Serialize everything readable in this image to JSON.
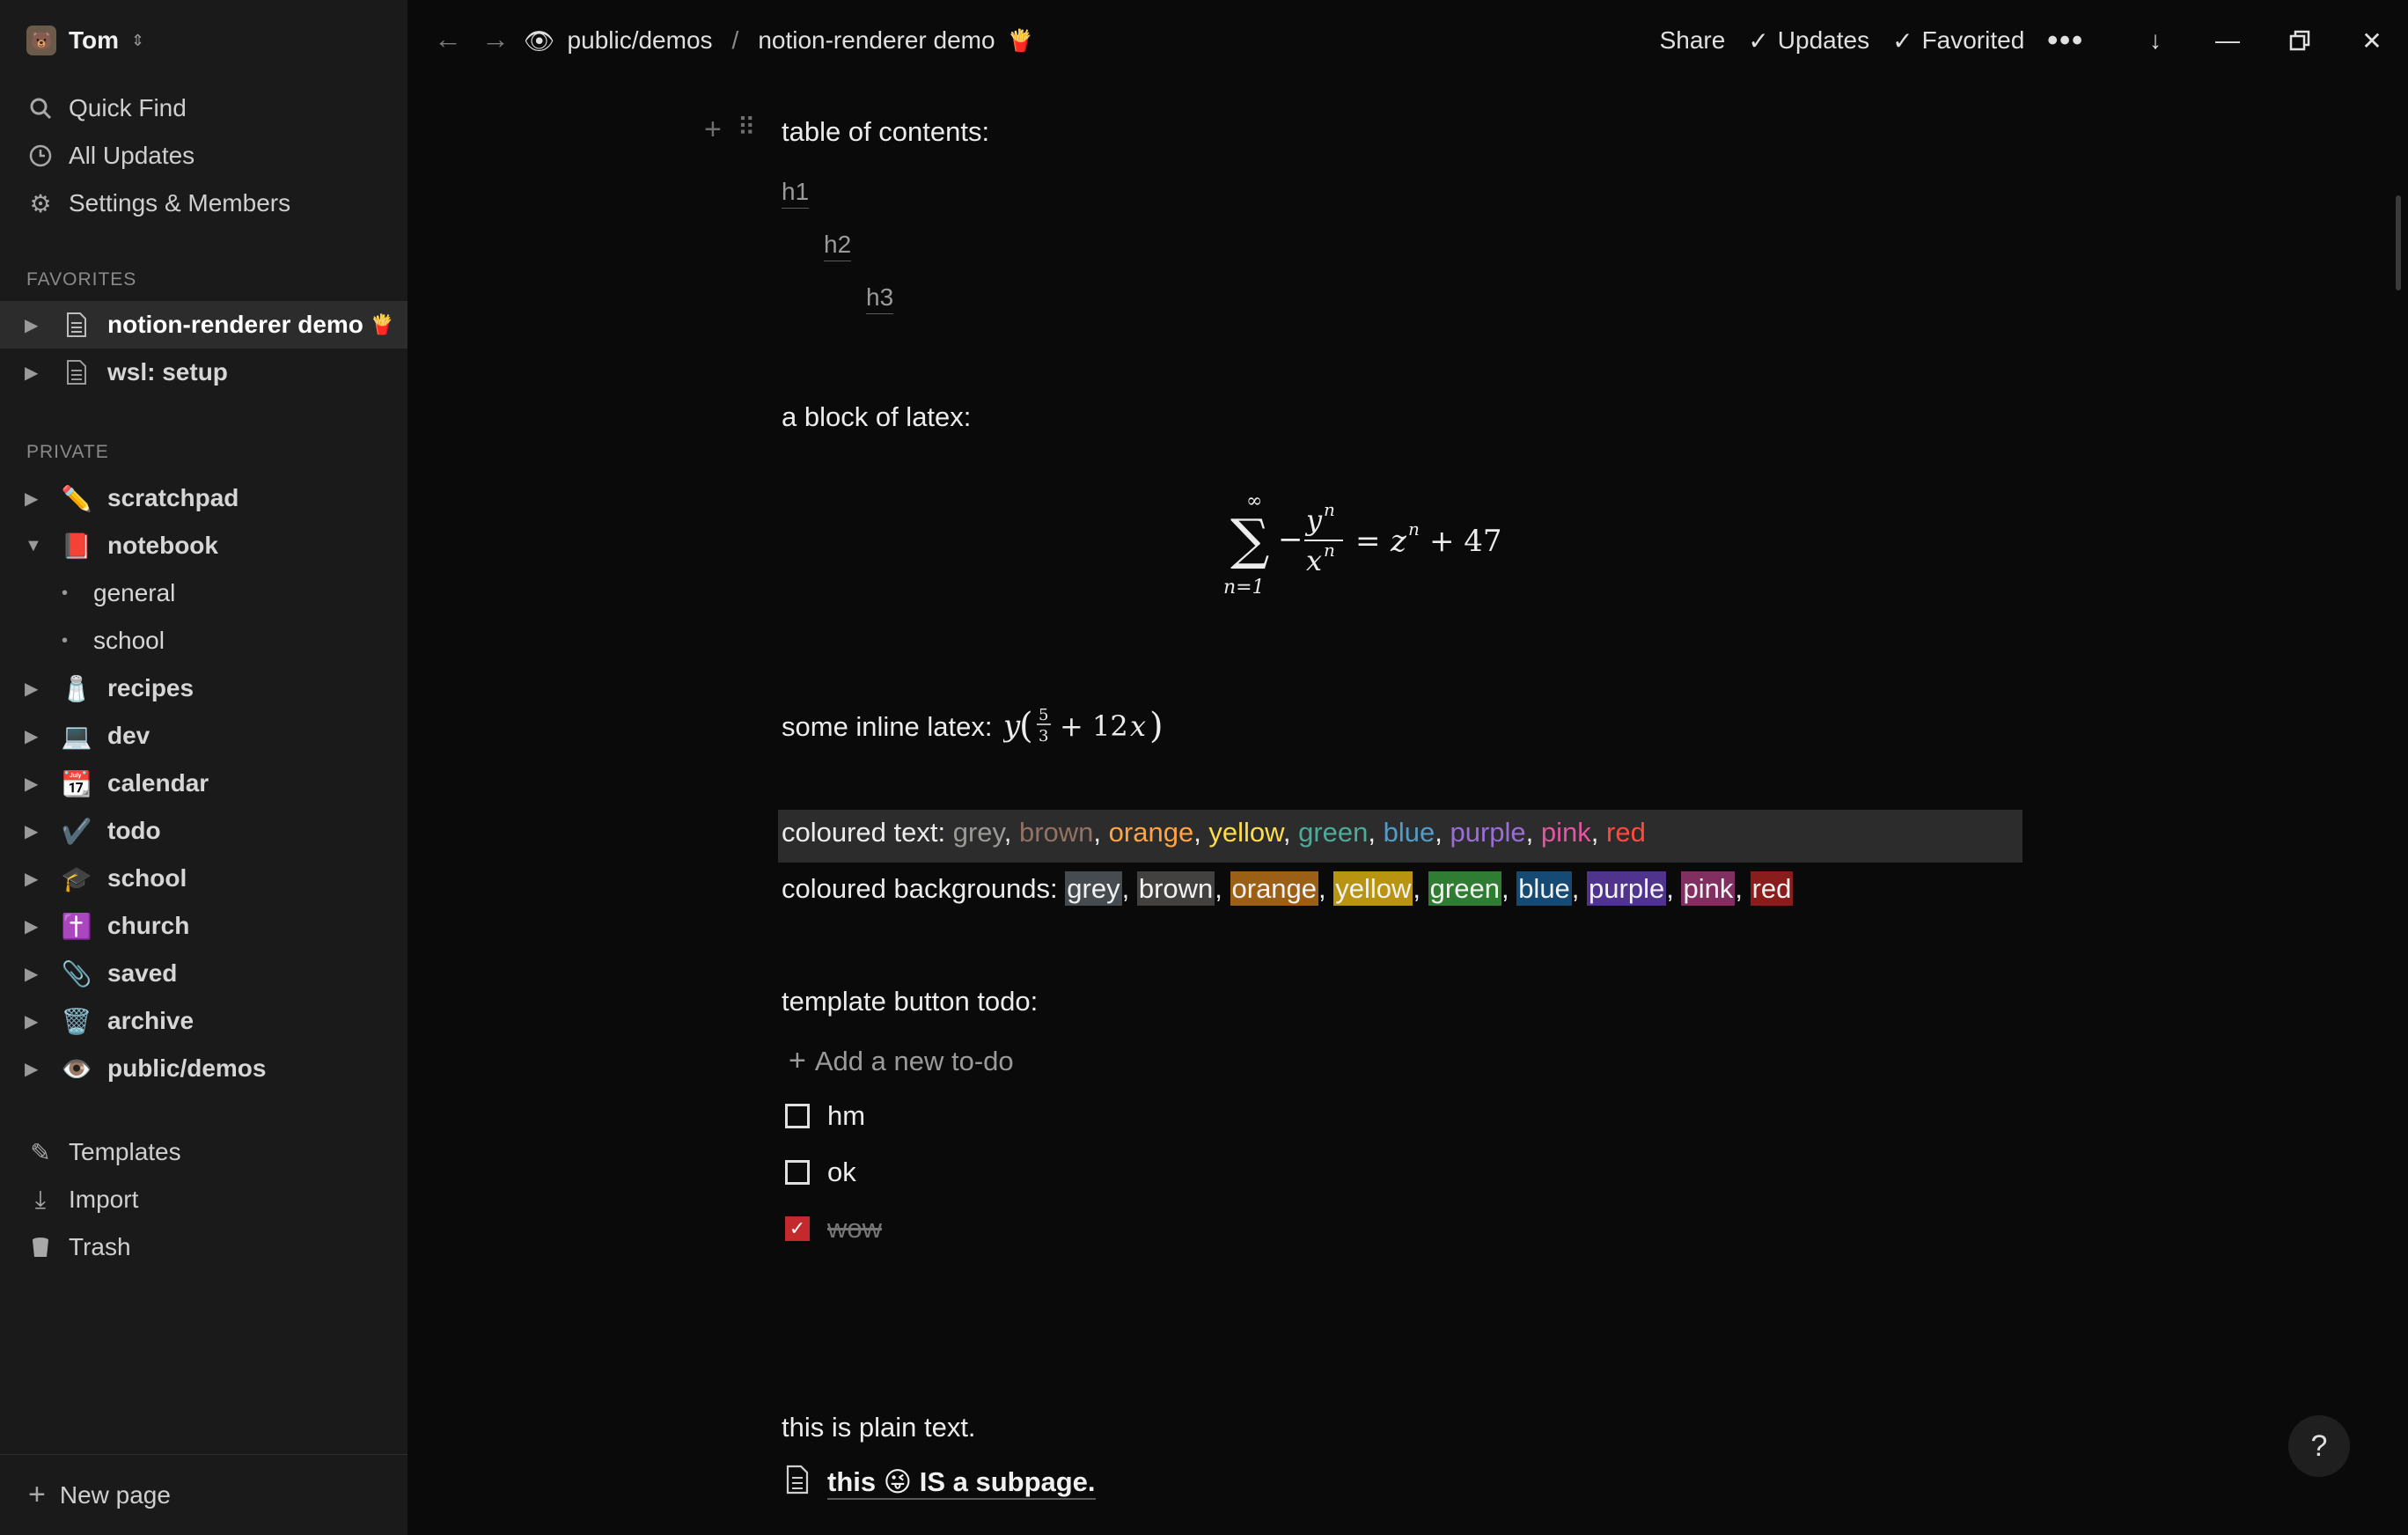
{
  "workspace": {
    "name": "Tom"
  },
  "sidebar": {
    "top": [
      "Quick Find",
      "All Updates",
      "Settings & Members"
    ],
    "favorites_label": "FAVORITES",
    "favorites": [
      {
        "label": "notion-renderer demo",
        "emoji": "🍟"
      },
      {
        "label": "wsl: setup"
      }
    ],
    "private_label": "PRIVATE",
    "private": [
      {
        "label": "scratchpad",
        "emoji": "✏️"
      },
      {
        "label": "notebook",
        "emoji": "📕"
      },
      {
        "label": "general"
      },
      {
        "label": "school"
      },
      {
        "label": "recipes",
        "emoji": "🧂"
      },
      {
        "label": "dev",
        "emoji": "💻"
      },
      {
        "label": "calendar",
        "emoji": "📆"
      },
      {
        "label": "todo",
        "emoji": "✔️"
      },
      {
        "label": "school",
        "emoji": "🎓"
      },
      {
        "label": "church",
        "emoji": "✝️"
      },
      {
        "label": "saved",
        "emoji": "📎"
      },
      {
        "label": "archive",
        "emoji": "🗑️"
      },
      {
        "label": "public/demos",
        "emoji": "👁️"
      }
    ],
    "bottom": [
      "Templates",
      "Import",
      "Trash"
    ],
    "new_page": "New page"
  },
  "topbar": {
    "crumb1": "public/demos",
    "crumb_sep": "/",
    "crumb2": "notion-renderer demo",
    "crumb2_emoji": "🍟",
    "share": "Share",
    "updates": "Updates",
    "favorited": "Favorited"
  },
  "content": {
    "toc_title": "table of contents:",
    "toc": [
      "h1",
      "h2",
      "h3"
    ],
    "latex_label": "a block of latex:",
    "inline_latex_label": "some inline latex:",
    "coloured_text_label": "coloured text:",
    "coloured_text": [
      {
        "t": "grey",
        "c": "#9b9a97"
      },
      {
        "t": "brown",
        "c": "#937264"
      },
      {
        "t": "orange",
        "c": "#ffa344"
      },
      {
        "t": "yellow",
        "c": "#ffdc49"
      },
      {
        "t": "green",
        "c": "#4dab9a"
      },
      {
        "t": "blue",
        "c": "#529cca"
      },
      {
        "t": "purple",
        "c": "#9a6dd7"
      },
      {
        "t": "pink",
        "c": "#e255a1"
      },
      {
        "t": "red",
        "c": "#ff4a3d"
      }
    ],
    "coloured_bg_label": "coloured backgrounds:",
    "coloured_bg": [
      {
        "t": "grey",
        "c": "#454b4e"
      },
      {
        "t": "brown",
        "c": "#434040"
      },
      {
        "t": "orange",
        "c": "#9c5f16"
      },
      {
        "t": "yellow",
        "c": "#b89411"
      },
      {
        "t": "green",
        "c": "#2f7d32"
      },
      {
        "t": "blue",
        "c": "#144a74"
      },
      {
        "t": "purple",
        "c": "#4f338c"
      },
      {
        "t": "pink",
        "c": "#812f60"
      },
      {
        "t": "red",
        "c": "#8b1c1c"
      }
    ],
    "template_label": "template button todo:",
    "add_todo": "Add a new to-do",
    "todos": [
      {
        "t": "hm",
        "done": false
      },
      {
        "t": "ok",
        "done": false
      },
      {
        "t": "wow",
        "done": true
      }
    ],
    "plain": "this is plain text.",
    "subpage_a": "this",
    "subpage_emoji": "😜",
    "subpage_b": "IS a subpage.",
    "help": "?"
  }
}
